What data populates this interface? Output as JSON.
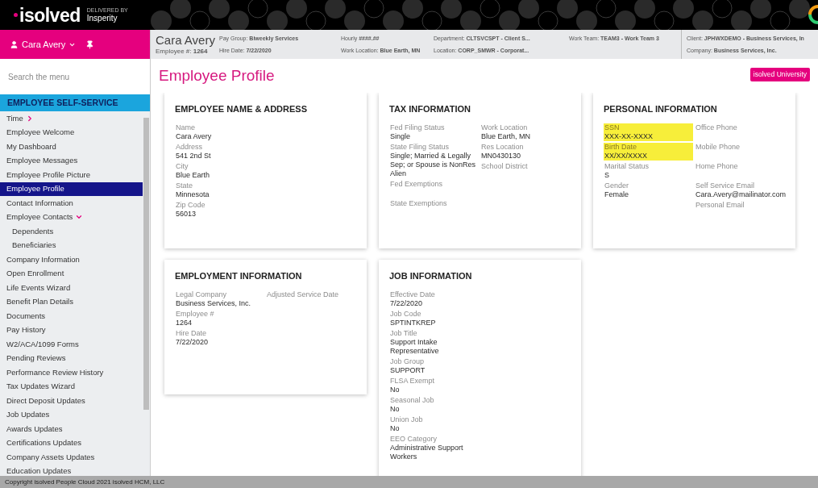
{
  "brand": {
    "logo": "isolved",
    "delivered_by": "DELIVERED BY",
    "partner": "Insperity"
  },
  "user_menu": {
    "name": "Cara Avery"
  },
  "employee_header": {
    "name": "Cara Avery",
    "employee_number": "Employee #: **1264**",
    "columns": [
      [
        "Pay Group: **Biweekly Services**",
        "Hire Date: **7/22/2020**"
      ],
      [
        "Hourly **####.##**",
        "Work Location: **Blue Earth, MN**"
      ],
      [
        "Department: **CLTSVCSPT - Client S...**",
        "Location: **CORP_SMWR - Corporat...**"
      ],
      [
        "Work Team: **TEAM3 - Work Team 3**"
      ],
      [
        "Client: **JPHWXDEMO - Business Services, In**",
        "Company: **Business Services, Inc.**"
      ]
    ]
  },
  "search": {
    "placeholder": "Search the menu"
  },
  "sidebar": {
    "section": "EMPLOYEE SELF-SERVICE",
    "items": [
      {
        "label": "Time",
        "selected": false,
        "kind": "group",
        "expanded": false
      },
      {
        "label": "Employee Welcome",
        "selected": false,
        "kind": "link"
      },
      {
        "label": "My Dashboard",
        "selected": false,
        "kind": "link"
      },
      {
        "label": "Employee Messages",
        "selected": false,
        "kind": "link"
      },
      {
        "label": "Employee Profile Picture",
        "selected": false,
        "kind": "link"
      },
      {
        "label": "Employee Profile",
        "selected": true,
        "kind": "link"
      },
      {
        "label": "Contact Information",
        "selected": false,
        "kind": "link"
      },
      {
        "label": "Employee Contacts",
        "selected": false,
        "kind": "group",
        "expanded": true,
        "children": [
          {
            "label": "Dependents",
            "selected": false,
            "kind": "link"
          },
          {
            "label": "Beneficiaries",
            "selected": false,
            "kind": "link"
          }
        ]
      },
      {
        "label": "Company Information",
        "selected": false,
        "kind": "link"
      },
      {
        "label": "Open Enrollment",
        "selected": false,
        "kind": "link"
      },
      {
        "label": "Life Events Wizard",
        "selected": false,
        "kind": "link"
      },
      {
        "label": "Benefit Plan Details",
        "selected": false,
        "kind": "link"
      },
      {
        "label": "Documents",
        "selected": false,
        "kind": "link"
      },
      {
        "label": "Pay History",
        "selected": false,
        "kind": "link"
      },
      {
        "label": "W2/ACA/1099 Forms",
        "selected": false,
        "kind": "link"
      },
      {
        "label": "Pending Reviews",
        "selected": false,
        "kind": "link"
      },
      {
        "label": "Performance Review History",
        "selected": false,
        "kind": "link"
      },
      {
        "label": "Tax Updates Wizard",
        "selected": false,
        "kind": "link"
      },
      {
        "label": "Direct Deposit Updates",
        "selected": false,
        "kind": "link"
      },
      {
        "label": "Job Updates",
        "selected": false,
        "kind": "link"
      },
      {
        "label": "Awards Updates",
        "selected": false,
        "kind": "link"
      },
      {
        "label": "Certifications Updates",
        "selected": false,
        "kind": "link"
      },
      {
        "label": "Company Assets Updates",
        "selected": false,
        "kind": "link"
      },
      {
        "label": "Education Updates",
        "selected": false,
        "kind": "link"
      }
    ]
  },
  "page_title": "Employee Profile",
  "university_button": "isolved University",
  "cards": [
    {
      "title": "EMPLOYEE NAME & ADDRESS",
      "columns": [
        [
          {
            "label": "Name",
            "value": "Cara Avery"
          },
          {
            "label": "Address",
            "value": "541 2nd St"
          },
          {
            "label": "City",
            "value": "Blue Earth"
          },
          {
            "label": "State",
            "value": "Minnesota"
          },
          {
            "label": "Zip Code",
            "value": "56013"
          }
        ]
      ]
    },
    {
      "title": "TAX INFORMATION",
      "columns": [
        [
          {
            "label": "Fed Filing Status",
            "value": "Single"
          },
          {
            "label": "State Filing Status",
            "value": "Single; Married & Legally Sep; or Spouse is NonRes Alien"
          },
          {
            "label": "Fed Exemptions"
          },
          {
            "label": "State Exemptions"
          }
        ],
        [
          {
            "label": "Work Location",
            "value": "Blue Earth, MN"
          },
          {
            "label": "Res Location",
            "value": "MN0430130"
          },
          {
            "label": "School District"
          }
        ]
      ]
    },
    {
      "title": "PERSONAL INFORMATION",
      "columns": [
        [
          {
            "label": "SSN",
            "value": "XXX-XX-XXXX",
            "highlighted": true
          },
          {
            "label": "Birth Date",
            "value": "XX/XX/XXXX",
            "highlighted": true
          },
          {
            "label": "Marital Status",
            "value": "S",
            "highlighted": false
          },
          {
            "label": "Gender",
            "value": "Female",
            "highlighted": false
          }
        ],
        [
          {
            "label": "Office Phone"
          },
          {
            "label": "Mobile Phone"
          },
          {
            "label": "Home Phone"
          },
          {
            "label": "Self Service Email",
            "value": "Cara.Avery@mailinator.com"
          },
          {
            "label": "Personal Email"
          }
        ]
      ]
    },
    {
      "title": "EMPLOYMENT INFORMATION",
      "columns": [
        [
          {
            "label": "Legal Company",
            "value": "Business Services, Inc."
          },
          {
            "label": "Employee #",
            "value": "1264"
          },
          {
            "label": "Hire Date",
            "value": "7/22/2020"
          }
        ],
        [
          {
            "label": "Adjusted Service Date"
          }
        ]
      ]
    },
    {
      "title": "JOB INFORMATION",
      "columns": [
        [
          {
            "label": "Effective Date",
            "value": "7/22/2020"
          },
          {
            "label": "Job Code",
            "value": "SPTINTKREP"
          },
          {
            "label": "Job Title",
            "value": "Support Intake Representative"
          },
          {
            "label": "Job Group",
            "value": "SUPPORT"
          },
          {
            "label": "FLSA Exempt",
            "value": "No"
          },
          {
            "label": "Seasonal Job",
            "value": "No"
          },
          {
            "label": "Union Job",
            "value": "No"
          },
          {
            "label": "EEO Category",
            "value": "Administrative Support Workers"
          }
        ]
      ]
    }
  ],
  "footer": "Copyright isolved People Cloud 2021 isolved HCM, LLC"
}
